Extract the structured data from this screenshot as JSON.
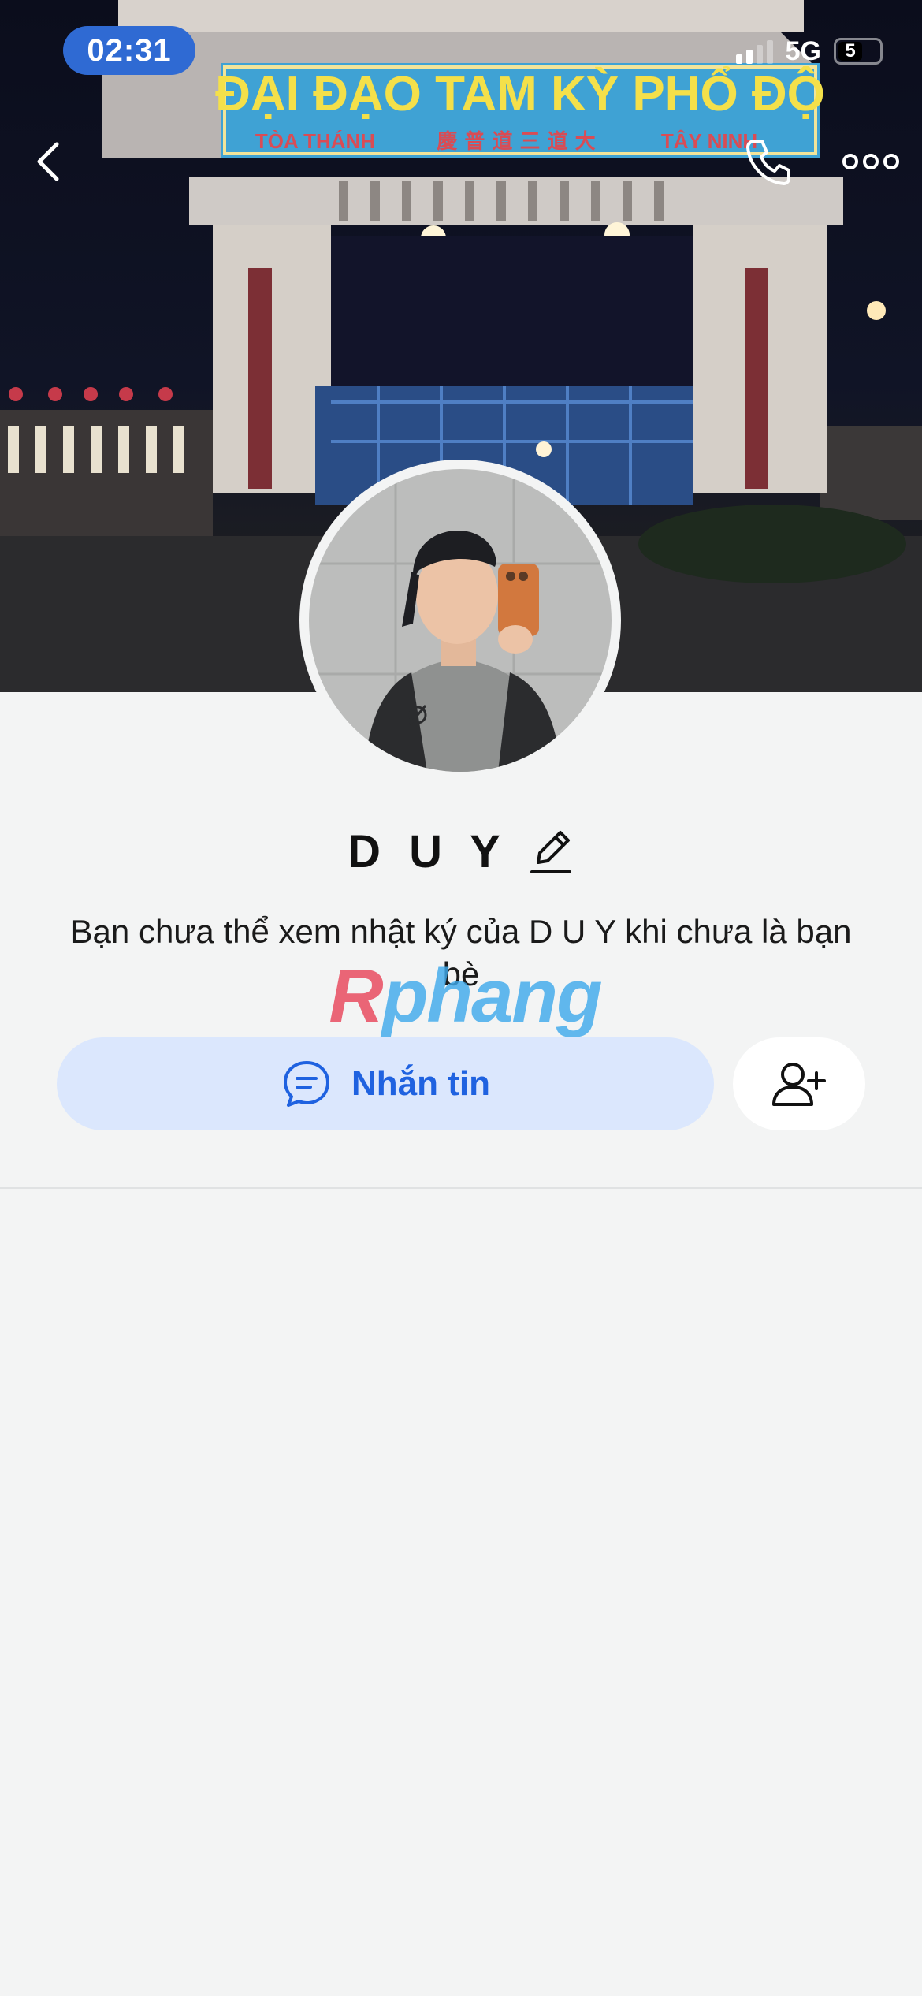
{
  "status_bar": {
    "time": "02:31",
    "network": "5G",
    "battery_level": "5",
    "signal_icon": "cellular-signal-icon",
    "battery_icon": "battery-icon"
  },
  "cover": {
    "sign_main_text": "ĐẠI ĐẠO TAM KỲ PHỔ ĐỘ",
    "sign_left_text": "TÒA THÁNH",
    "sign_chinese_text": "慶 普 道 三 道 大",
    "sign_right_text": "TÂY NINH"
  },
  "header": {
    "back_icon": "chevron-left-icon",
    "call_icon": "phone-icon",
    "more_icon": "more-dots-icon"
  },
  "profile": {
    "name": "D U Y",
    "edit_icon": "pencil-icon",
    "notice": "Bạn chưa thể xem nhật ký của D U Y khi chưa là bạn bè"
  },
  "actions": {
    "message_label": "Nhắn tin",
    "message_icon": "chat-bubble-icon",
    "add_friend_icon": "add-friend-icon"
  },
  "watermark": {
    "first_letter": "R",
    "rest": "phang"
  },
  "colors": {
    "accent": "#1f62e0",
    "message_button_bg": "#dbe7fd",
    "time_pill": "#2f6ad3",
    "page_bg": "#f3f4f4"
  }
}
